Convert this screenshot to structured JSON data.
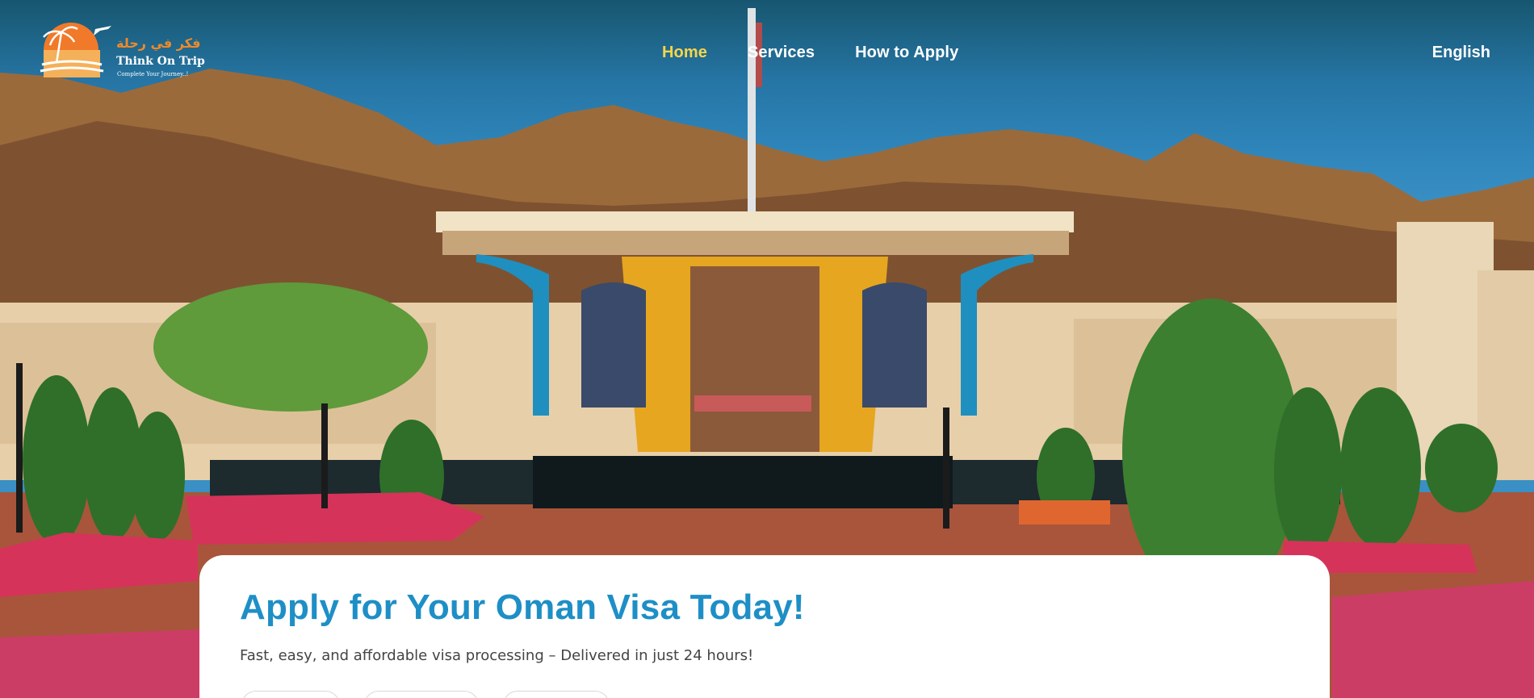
{
  "brand": {
    "arabic_name": "فكر في رحلة",
    "name": "Think On Trip",
    "tagline": "Complete Your Journey..!"
  },
  "nav": {
    "items": [
      {
        "label": "Home",
        "active": true
      },
      {
        "label": "Services",
        "active": false
      },
      {
        "label": "How to Apply",
        "active": false
      }
    ],
    "language": "English"
  },
  "hero": {
    "title": "Apply for Your Oman Visa Today!",
    "subtitle": "Fast, easy, and affordable visa processing – Delivered in just 24 hours!"
  },
  "colors": {
    "accent_title": "#1e8fc6",
    "nav_active": "#f7d64a",
    "brand_orange": "#f08a2a"
  }
}
